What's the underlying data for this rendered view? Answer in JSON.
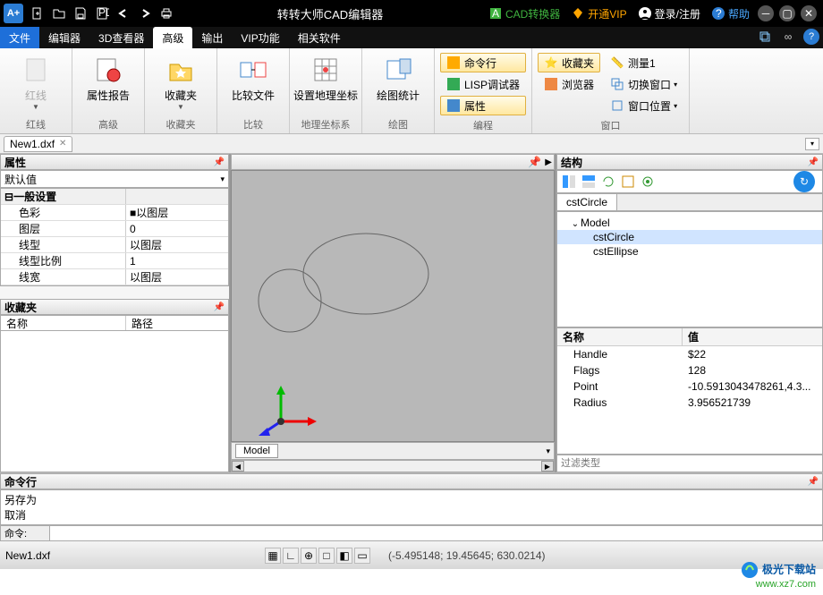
{
  "title": "转转大师CAD编辑器",
  "titlebar_right": {
    "converter": "CAD转换器",
    "vip": "开通VIP",
    "login": "登录/注册",
    "help": "帮助"
  },
  "menu": {
    "file": "文件",
    "items": [
      "编辑器",
      "3D查看器",
      "高级",
      "输出",
      "VIP功能",
      "相关软件"
    ],
    "active": "高级"
  },
  "ribbon": {
    "groups": {
      "redline": {
        "label": "红线",
        "btn": "红线"
      },
      "advanced": {
        "label": "高级",
        "btn": "属性报告"
      },
      "favorites": {
        "label": "收藏夹",
        "btn": "收藏夹"
      },
      "compare": {
        "label": "比较",
        "btn": "比较文件"
      },
      "geo": {
        "label": "地理坐标系",
        "btn": "设置地理坐标"
      },
      "draw": {
        "label": "绘图",
        "btn": "绘图统计"
      },
      "prog": {
        "label": "编程",
        "cmd": "命令行",
        "lisp": "LISP调试器",
        "prop": "属性"
      },
      "window": {
        "label": "窗口",
        "fav": "收藏夹",
        "browser": "浏览器",
        "measure": "测量1",
        "switch": "切换窗口",
        "pos": "窗口位置"
      }
    }
  },
  "doctab": "New1.dxf",
  "left": {
    "prop_title": "属性",
    "default": "默认值",
    "group": "一般设置",
    "rows": {
      "color": {
        "k": "色彩",
        "v": "■以图层"
      },
      "layer": {
        "k": "图层",
        "v": "0"
      },
      "ltype": {
        "k": "线型",
        "v": "以图层"
      },
      "lscale": {
        "k": "线型比例",
        "v": "1"
      },
      "lweight": {
        "k": "线宽",
        "v": "以图层"
      }
    },
    "fav_title": "收藏夹",
    "fav_cols": {
      "name": "名称",
      "path": "路径"
    }
  },
  "canvas": {
    "tab": "Model"
  },
  "right": {
    "title": "结构",
    "tree": {
      "tab": "cstCircle",
      "root": "Model",
      "items": [
        "cstCircle",
        "cstEllipse"
      ],
      "selected": "cstCircle"
    },
    "props": {
      "cols": {
        "name": "名称",
        "value": "值"
      },
      "rows": [
        {
          "k": "Handle",
          "v": "$22"
        },
        {
          "k": "Flags",
          "v": "128"
        },
        {
          "k": "Point",
          "v": "-10.5913043478261,4.3..."
        },
        {
          "k": "Radius",
          "v": "3.956521739"
        }
      ]
    },
    "filter_placeholder": "过滤类型"
  },
  "cmd": {
    "title": "命令行",
    "log": [
      "另存为",
      "取消"
    ],
    "prompt": "命令:"
  },
  "status": {
    "file": "New1.dxf",
    "coords": "(-5.495148; 19.45645; 630.0214)"
  },
  "watermark": {
    "l1": "极光下载站",
    "l2": "www.xz7.com"
  }
}
